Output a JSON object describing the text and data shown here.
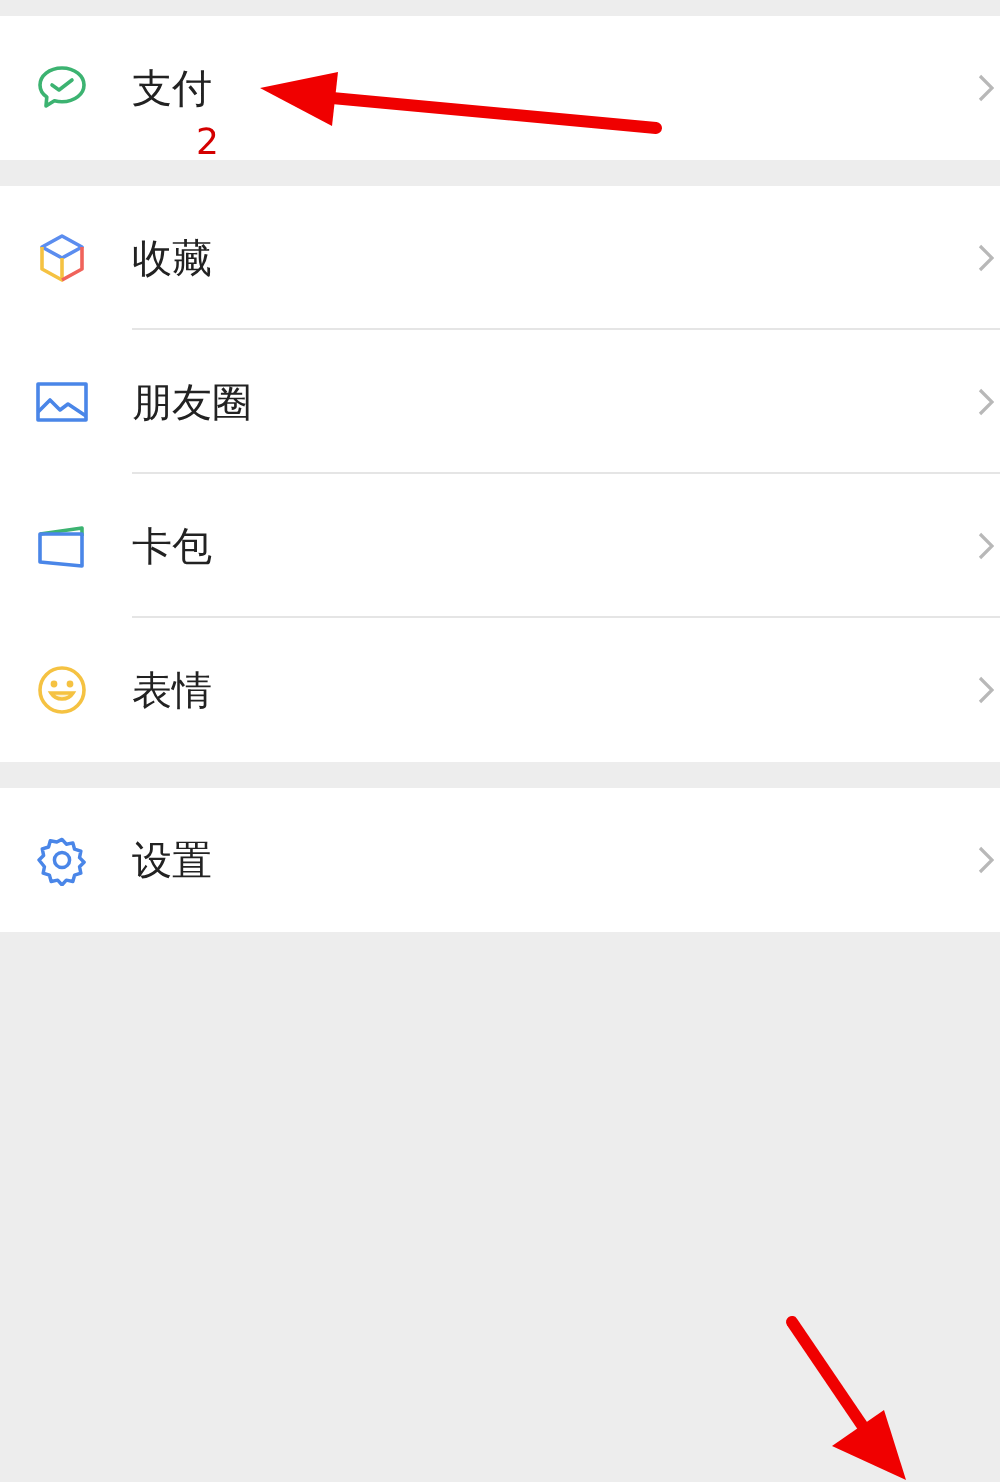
{
  "groups": [
    {
      "items": [
        {
          "kind": "pay",
          "label": "支付"
        }
      ]
    },
    {
      "items": [
        {
          "kind": "favorites",
          "label": "收藏"
        },
        {
          "kind": "moments",
          "label": "朋友圈"
        },
        {
          "kind": "cards",
          "label": "卡包"
        },
        {
          "kind": "stickers",
          "label": "表情"
        }
      ]
    },
    {
      "items": [
        {
          "kind": "settings",
          "label": "设置"
        }
      ]
    }
  ],
  "annotation": {
    "step_number": "2"
  }
}
